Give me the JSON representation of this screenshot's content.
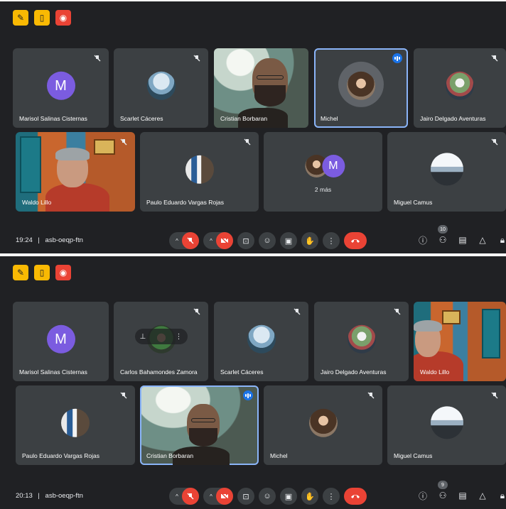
{
  "screenshots": [
    {
      "time": "19:24",
      "meeting_code": "asb-oeqp-ftn",
      "participants_count": "10",
      "tiles": [
        {
          "name": "Marisol Salinas Cisternas",
          "letter": "M"
        },
        {
          "name": "Scarlet Cáceres"
        },
        {
          "name": "Cristian Borbaran"
        },
        {
          "name": "Michel"
        },
        {
          "name": "Jairo Delgado Aventuras"
        },
        {
          "name": "Waldo Lillo"
        },
        {
          "name": "Paulo Eduardo Vargas Rojas"
        },
        {
          "others_label": "2 más",
          "letter": "M"
        },
        {
          "name": "Miguel Camus"
        }
      ]
    },
    {
      "time": "20:13",
      "meeting_code": "asb-oeqp-ftn",
      "participants_count": "9",
      "tiles": [
        {
          "name": "Marisol Salinas Cisternas",
          "letter": "M"
        },
        {
          "name": "Carlos Bahamondes Zamora"
        },
        {
          "name": "Scarlet Cáceres"
        },
        {
          "name": "Jairo Delgado Aventuras"
        },
        {
          "name": "Waldo Lillo"
        },
        {
          "name": "Paulo Eduardo Vargas Rojas"
        },
        {
          "name": "Cristian Borbaran"
        },
        {
          "name": "Michel"
        },
        {
          "name": "Miguel Camus"
        }
      ]
    }
  ],
  "separator": "|",
  "colors": {
    "background": "#202124",
    "tile": "#3c4043",
    "active_border": "#8ab4f8",
    "end_call": "#ea4335",
    "avatar": "#7b5ce0",
    "speaking": "#1a73e8"
  }
}
